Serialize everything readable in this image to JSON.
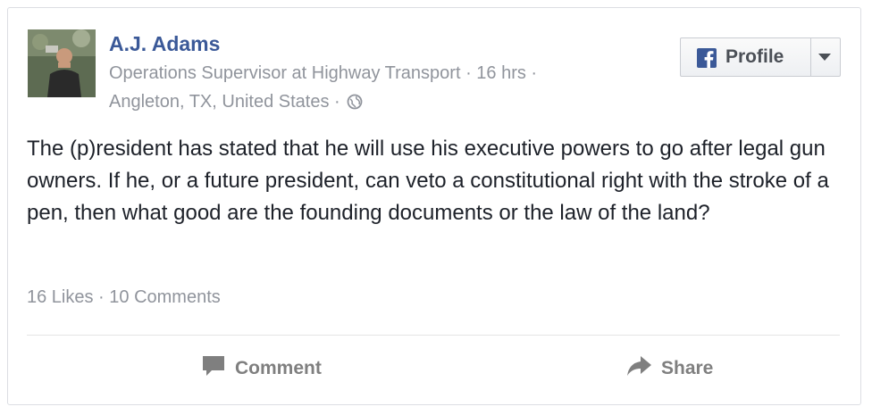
{
  "post": {
    "author": "A.J. Adams",
    "meta_line1": "Operations Supervisor at Highway Transport · 16 hrs ·",
    "meta_line2": "Angleton, TX, United States ·",
    "text": "The (p)resident has stated that he will use his executive powers to go after legal gun owners. If he, or a future president, can veto a constitutional right with the stroke of a pen, then what good are the founding documents or the law of the land?",
    "stats": "16 Likes · 10 Comments"
  },
  "profile_button": {
    "label": "Profile",
    "icon": "facebook-icon"
  },
  "actions": {
    "comment_label": "Comment",
    "share_label": "Share",
    "comment_icon": "comment-icon",
    "share_icon": "share-icon"
  },
  "colors": {
    "author": "#3b5998",
    "meta": "#90949c",
    "text": "#1d2129",
    "action": "#7f7f7f",
    "facebook_brand": "#3b5998"
  }
}
